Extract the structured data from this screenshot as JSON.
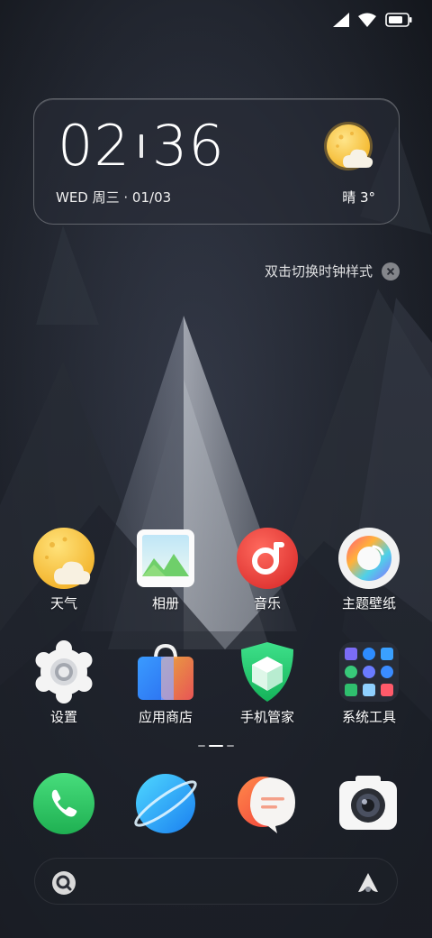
{
  "status_bar": {
    "icons": [
      "cellular-signal-icon",
      "wifi-icon",
      "battery-icon"
    ]
  },
  "clock_widget": {
    "hours": "02",
    "minutes": "36",
    "date": "WED 周三 · 01/03",
    "weather": "晴 3°",
    "weather_icon": "sun-cloud-icon"
  },
  "hint": {
    "text": "双击切换时钟样式"
  },
  "apps": {
    "weather": {
      "label": "天气"
    },
    "gallery": {
      "label": "相册"
    },
    "music": {
      "label": "音乐"
    },
    "themes": {
      "label": "主题壁纸"
    },
    "settings": {
      "label": "设置"
    },
    "app_store": {
      "label": "应用商店"
    },
    "phone_manager": {
      "label": "手机管家"
    },
    "system_tools": {
      "label": "系统工具"
    }
  },
  "dock": [
    "phone-icon",
    "browser-icon",
    "messages-icon",
    "camera-icon"
  ],
  "search": {
    "left_icon": "search-icon",
    "right_icon": "assistant-icon"
  },
  "colors": {
    "accent_yellow": "#f7c63a",
    "accent_green": "#2fc46a",
    "accent_red": "#e8443a",
    "accent_blue": "#2a9cf0"
  }
}
